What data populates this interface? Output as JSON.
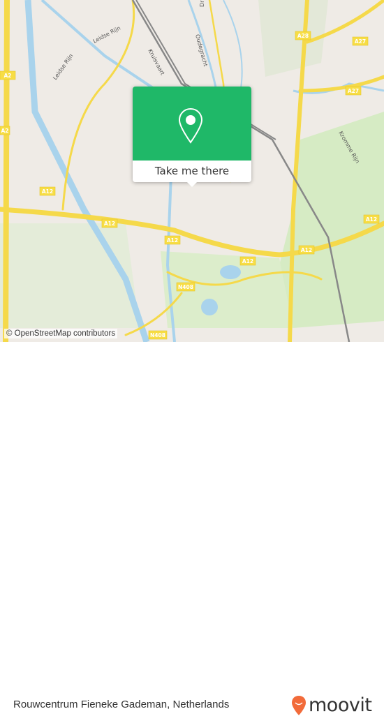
{
  "map": {
    "labels": {
      "leidse_rijn_1": "Leidse Rijn",
      "leidse_rijn_2": "Leidse Rijn",
      "kruisvaart": "Kruisvaart",
      "oudegracht": "Oudegracht",
      "kromme_rijn": "Kromme Rijn",
      "dr": "Dr"
    },
    "shields": {
      "a2_top": "A2",
      "a2_left": "A2",
      "a28": "A28",
      "a27_top": "A27",
      "a27_right": "A27",
      "a12_1": "A12",
      "a12_2": "A12",
      "a12_3": "A12",
      "a12_4": "A12",
      "a12_5": "A12",
      "a12_6": "A12",
      "n408_1": "N408",
      "n408_2": "N408"
    },
    "attribution": "© OpenStreetMap contributors",
    "colors": {
      "land": "#efebe6",
      "water": "#a9d3ec",
      "road": "#f5d94a",
      "green": "#d6ebc4",
      "popup": "#1fb868"
    }
  },
  "popup": {
    "button_label": "Take me there",
    "icon": "location-pin-icon"
  },
  "footer": {
    "place": "Rouwcentrum Fieneke Gademan, Netherlands",
    "brand": "moovit",
    "brand_color": "#f26b3a"
  }
}
